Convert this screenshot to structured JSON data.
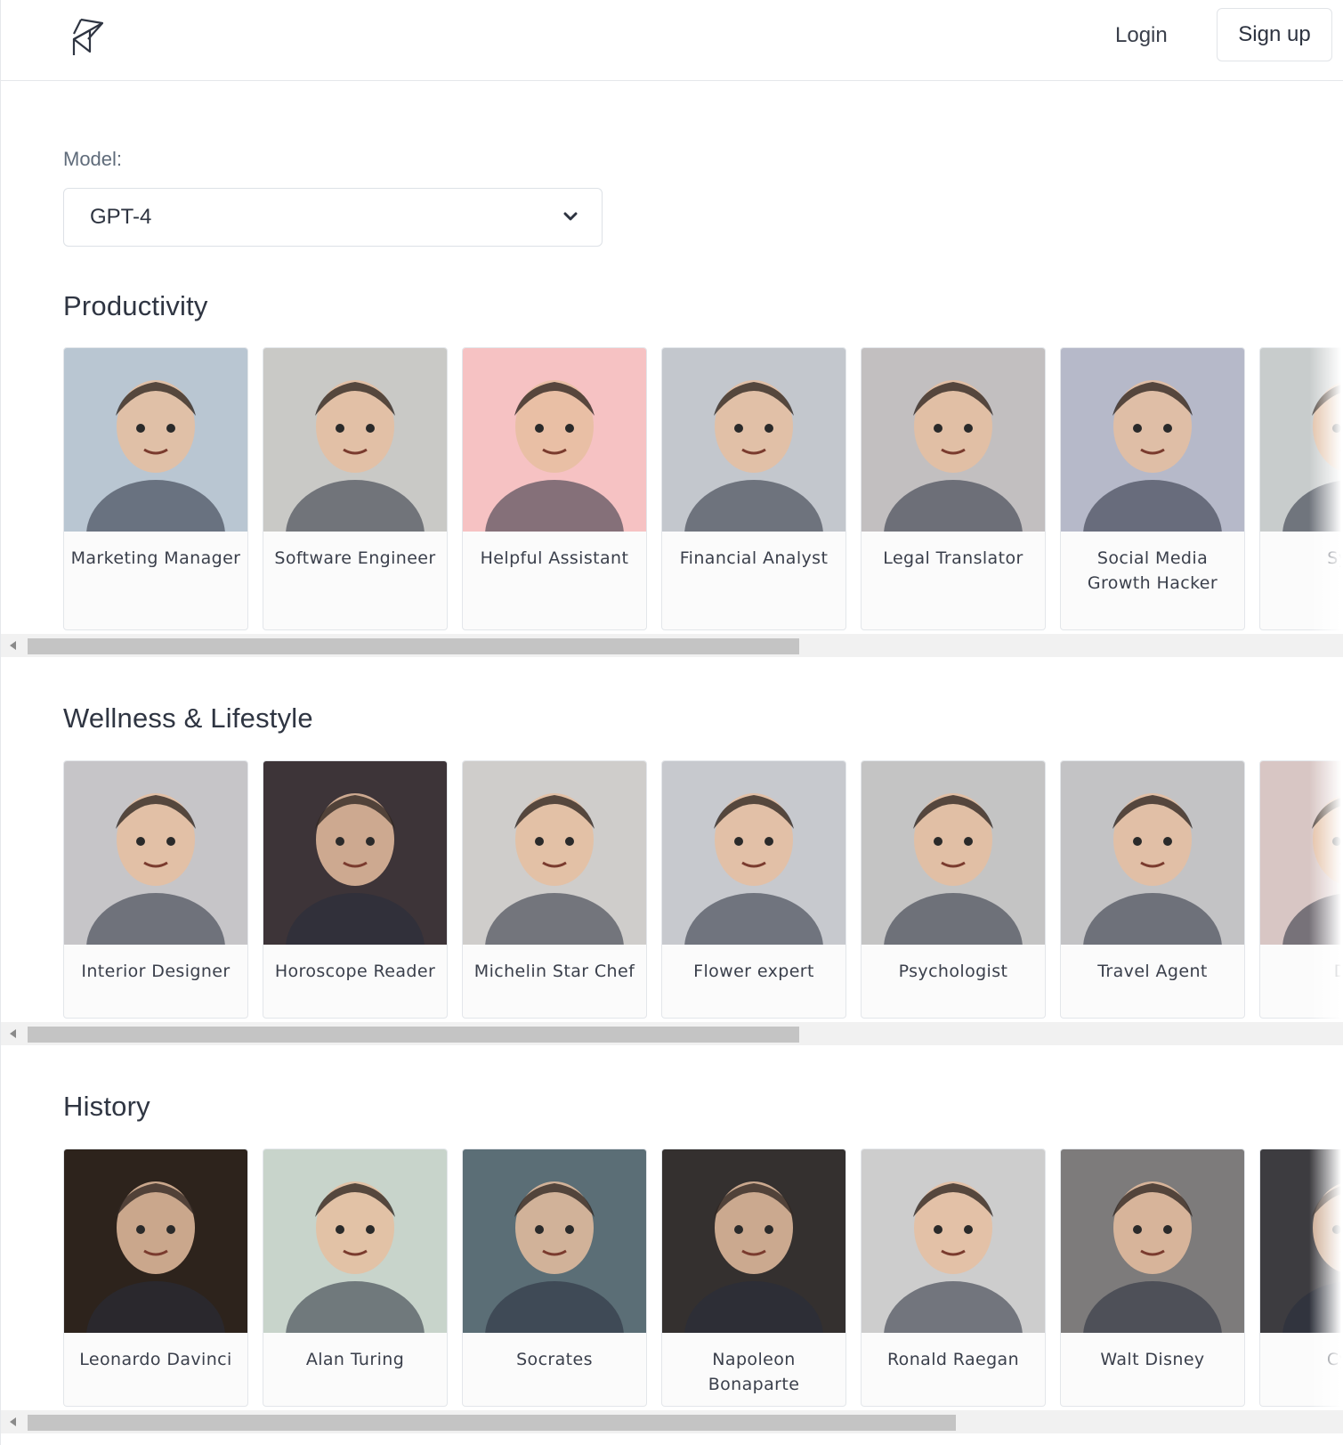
{
  "header": {
    "login_label": "Login",
    "signup_label": "Sign up"
  },
  "model": {
    "label": "Model:",
    "selected": "GPT-4"
  },
  "sections": [
    {
      "title": "Productivity",
      "scroll_fraction_visible": 0.59,
      "cards": [
        {
          "label": "Marketing Manager",
          "bg": "#b9c6d2"
        },
        {
          "label": "Software Engineer",
          "bg": "#c9c9c6"
        },
        {
          "label": "Helpful Assistant",
          "bg": "#f6c2c3"
        },
        {
          "label": "Financial Analyst",
          "bg": "#c3c7cd"
        },
        {
          "label": "Legal Translator",
          "bg": "#c2bfc0"
        },
        {
          "label": "Social Media Growth Hacker",
          "bg": "#b6b9c9"
        },
        {
          "label": "Sy En",
          "bg": "#c8cccc"
        }
      ]
    },
    {
      "title": "Wellness & Lifestyle",
      "scroll_fraction_visible": 0.59,
      "cards": [
        {
          "label": "Interior Designer",
          "bg": "#c6c5c8"
        },
        {
          "label": "Horoscope Reader",
          "bg": "#3d3438"
        },
        {
          "label": "Michelin Star Chef",
          "bg": "#cfcdcb"
        },
        {
          "label": "Flower expert",
          "bg": "#c7c9ce"
        },
        {
          "label": "Psychologist",
          "bg": "#c4c4c4"
        },
        {
          "label": "Travel Agent",
          "bg": "#c3c3c5"
        },
        {
          "label": "Dati",
          "bg": "#d8c6c4"
        }
      ]
    },
    {
      "title": "History",
      "scroll_fraction_visible": 0.71,
      "cards": [
        {
          "label": "Leonardo Davinci",
          "bg": "#2d231c"
        },
        {
          "label": "Alan Turing",
          "bg": "#c8d4cb"
        },
        {
          "label": "Socrates",
          "bg": "#5b6e76"
        },
        {
          "label": "Napoleon Bonaparte",
          "bg": "#34302f"
        },
        {
          "label": "Ronald Raegan",
          "bg": "#cdcdcd"
        },
        {
          "label": "Walt Disney",
          "bg": "#7d7b7b"
        },
        {
          "label": "Cyrus",
          "bg": "#3d3c40"
        }
      ]
    }
  ]
}
